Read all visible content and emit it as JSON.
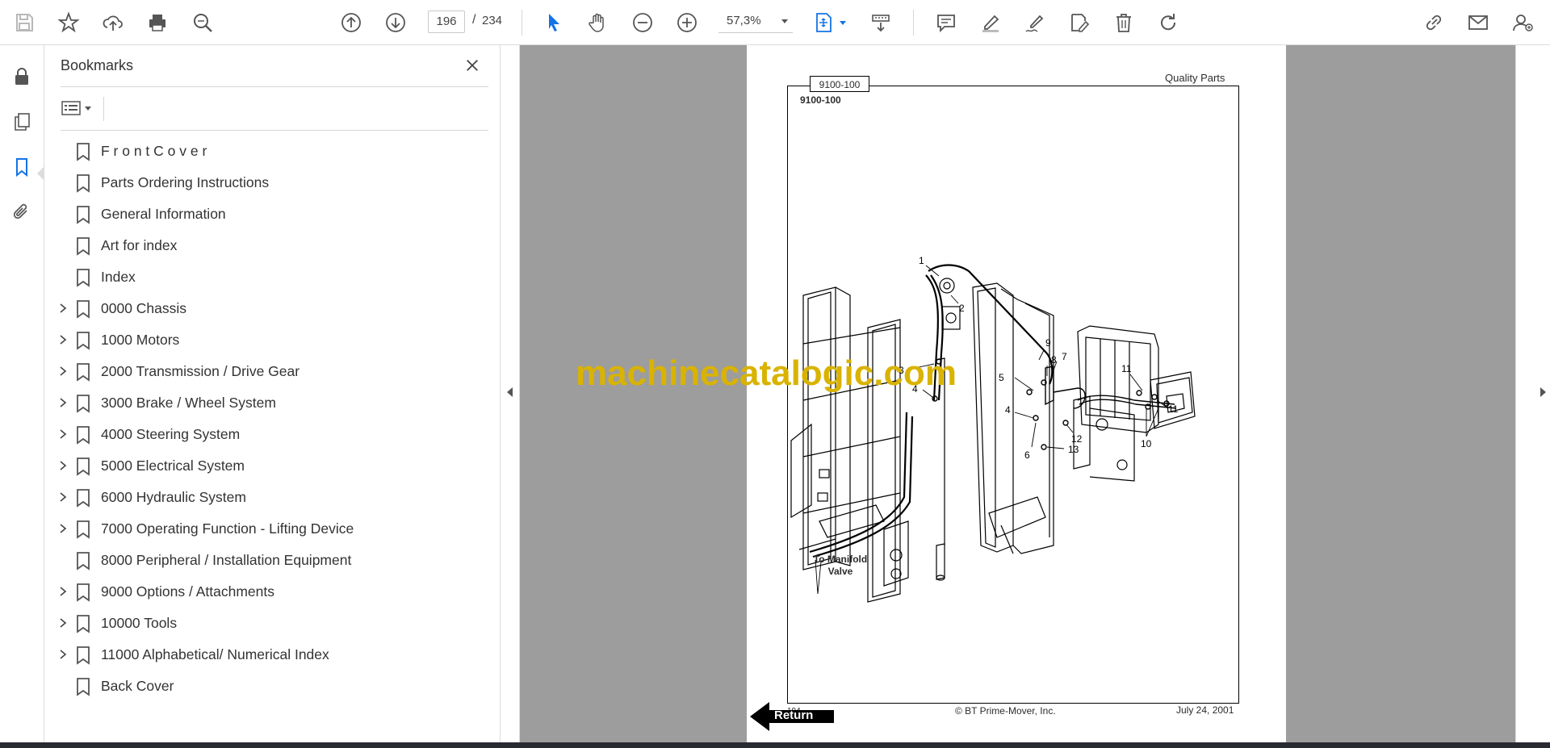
{
  "toolbar": {
    "page_current": "196",
    "page_separator": "/",
    "page_total": "234",
    "zoom": "57,3%"
  },
  "bookmarks": {
    "title": "Bookmarks",
    "items": [
      {
        "label": "F r o n t C o v e r",
        "expandable": false
      },
      {
        "label": "Parts Ordering Instructions",
        "expandable": false
      },
      {
        "label": "General Information",
        "expandable": false
      },
      {
        "label": "Art for index",
        "expandable": false
      },
      {
        "label": "Index",
        "expandable": false
      },
      {
        "label": "0000 Chassis",
        "expandable": true
      },
      {
        "label": "1000 Motors",
        "expandable": true
      },
      {
        "label": "2000 Transmission / Drive Gear",
        "expandable": true
      },
      {
        "label": "3000 Brake / Wheel System",
        "expandable": true
      },
      {
        "label": "4000 Steering System",
        "expandable": true
      },
      {
        "label": "5000 Electrical System",
        "expandable": true
      },
      {
        "label": "6000 Hydraulic System",
        "expandable": true
      },
      {
        "label": "7000 Operating Function - Lifting Device",
        "expandable": true
      },
      {
        "label": "8000 Peripheral / Installation Equipment",
        "expandable": false
      },
      {
        "label": "9000 Options / Attachments",
        "expandable": true
      },
      {
        "label": "10000 Tools",
        "expandable": true
      },
      {
        "label": "11000 Alphabetical/ Numerical Index",
        "expandable": true
      },
      {
        "label": "Back Cover",
        "expandable": false
      }
    ]
  },
  "document": {
    "tag": "9100-100",
    "header_right": "Quality Parts",
    "subtitle": "9100-100",
    "callouts": [
      "1",
      "2",
      "3",
      "4",
      "5",
      "9",
      "8",
      "7",
      "4",
      "6",
      "12",
      "13",
      "11",
      "11",
      "10"
    ],
    "manifold_line1": "To Manifold",
    "manifold_line2": "Valve",
    "copyright": "© BT Prime-Mover, Inc.",
    "date": "July 24, 2001",
    "page_number": "194",
    "return_label": "Return"
  },
  "watermark": "machinecatalogic.com",
  "colors": {
    "accent_blue": "#1473e6",
    "doc_background": "#9d9d9d",
    "watermark": "#d9b300"
  }
}
